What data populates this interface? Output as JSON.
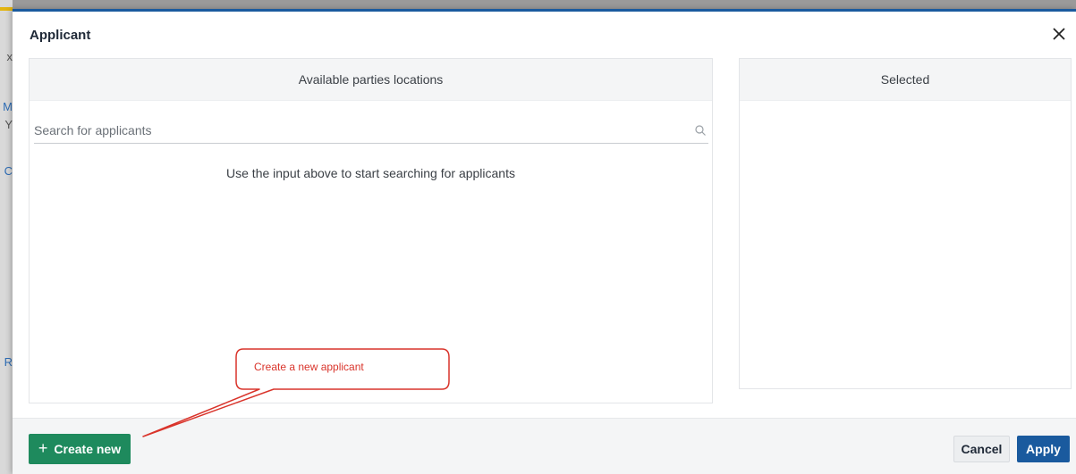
{
  "background": {
    "letters": [
      {
        "text": "x",
        "color": "#555555"
      },
      {
        "text": "M",
        "color": "#2d6cb5"
      },
      {
        "text": "Y",
        "color": "#555555"
      },
      {
        "text": "C",
        "color": "#2d6cb5"
      },
      {
        "text": "R",
        "color": "#2d6cb5"
      }
    ]
  },
  "dialog": {
    "title": "Applicant",
    "close_icon": "close-icon"
  },
  "available_panel": {
    "header": "Available parties locations",
    "search_placeholder": "Search for applicants",
    "search_value": "",
    "search_icon": "search-icon",
    "empty_message": "Use the input above to start searching for applicants"
  },
  "selected_panel": {
    "header": "Selected",
    "items": []
  },
  "footer": {
    "create_label": "Create new",
    "create_icon": "plus-icon",
    "cancel_label": "Cancel",
    "apply_label": "Apply"
  },
  "annotation": {
    "text": "Create a new applicant",
    "color": "#d9342b"
  },
  "colors": {
    "accent": "#1a5a9e",
    "create_button": "#1e8a5d",
    "annotation": "#d9342b"
  }
}
